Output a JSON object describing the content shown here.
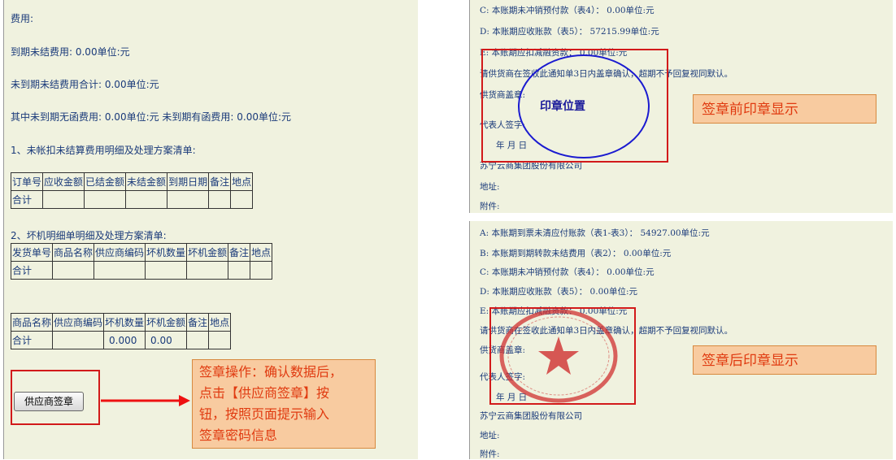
{
  "left": {
    "lines": [
      "费用:",
      "到期未结费用:  0.00单位:元",
      "未到期未结费用合计:  0.00单位:元",
      "其中未到期无函费用:  0.00单位:元  未到期有函费用:  0.00单位:元",
      "1、未帐扣未结算费用明细及处理方案清单:",
      "2、坏机明细单明细及处理方案清单:"
    ],
    "table1": {
      "headers": [
        "订单号",
        "应收金额",
        "已结金额",
        "未结金额",
        "到期日期",
        "备注",
        "地点"
      ],
      "row": [
        "合计",
        "",
        "",
        "",
        "",
        "",
        ""
      ]
    },
    "table2": {
      "headers": [
        "发货单号",
        "商品名称",
        "供应商编码",
        "坏机数量",
        "坏机金额",
        "备注",
        "地点"
      ],
      "row": [
        "合计",
        "",
        "",
        "",
        "",
        "",
        ""
      ]
    },
    "table3": {
      "headers": [
        "商品名称",
        "供应商编码",
        "坏机数量",
        "坏机金额",
        "备注",
        "地点"
      ],
      "row": [
        "合计",
        "",
        "0.000",
        "0.00",
        "",
        ""
      ]
    },
    "button_label": "供应商签章",
    "callout": [
      "签章操作：确认数据后，",
      "点击【供应商签章】按",
      "钮，按照页面提示输入",
      "签章密码信息"
    ]
  },
  "right_top": {
    "lines": [
      "C:  本账期未冲销预付款（表4）：  0.00单位:元",
      "D:  本账期应收账款（表5）：  57215.99单位:元",
      "E:  本账期应扣减融资款：  0.00单位:元",
      "请供货商在签收此通知单3日内盖章确认，超期不予回复视同默认。",
      "供货商盖章:",
      "代表人签字:",
      "年   月   日",
      "苏宁云商集团股份有限公司",
      "地址:",
      "附件:"
    ],
    "stamp_label": "印章位置",
    "callout": "签章前印章显示"
  },
  "right_bottom": {
    "lines": [
      "A:  本账期到票未清应付账款（表1-表3）：  54927.00单位:元",
      "B:  本账期到期转款未结费用（表2）：  0.00单位:元",
      "C:  本账期未冲销预付款（表4）：  0.00单位:元",
      "D:  本账期应收账款（表5）：  0.00单位:元",
      "E:  本账期应扣减融资款：  0.00单位:元",
      "请供货商在签收此通知单3日内盖章确认，超期不予回复视同默认。",
      "供货商盖章:",
      "代表人签字:",
      "年   月   日",
      "苏宁云商集团股份有限公司",
      "地址:",
      "附件:"
    ],
    "callout": "签章后印章显示"
  },
  "colors": {
    "text": "#1a3a7a",
    "highlight": "#d21a1a",
    "callout_bg": "#f8cba0",
    "stamp_blue": "#1a1ad0"
  }
}
